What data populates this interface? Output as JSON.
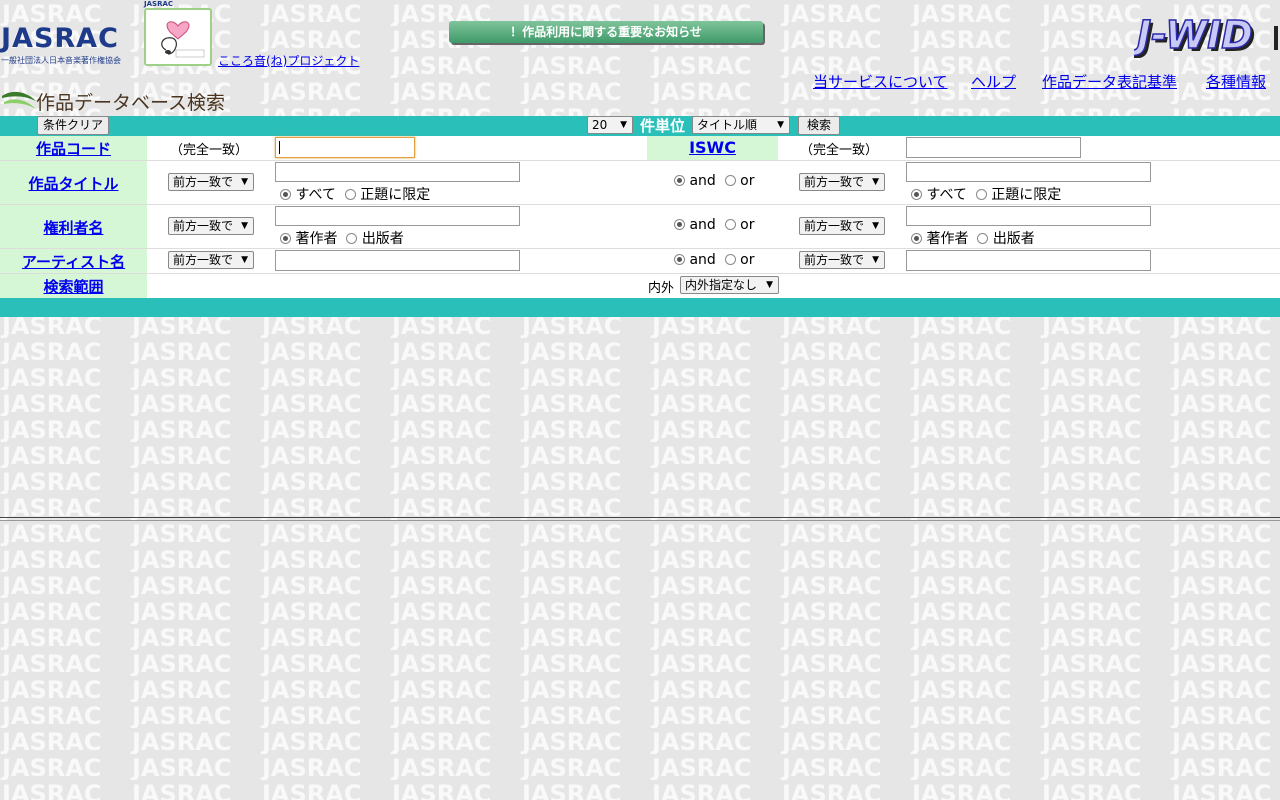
{
  "header": {
    "logo_text": "JASRAC",
    "logo_subtitle": "一般社団法人日本音楽著作権協会",
    "kokoro_mini": "JASRAC",
    "kokoro_link": "こころ音(ね)プロジェクト",
    "notice_button": "！作品利用に関する重要なお知らせ",
    "jwid_logo": "J-WID",
    "nav": {
      "about": "当サービスについて",
      "help": "ヘルプ",
      "notation": "作品データ表記基準",
      "info": "各種情報"
    },
    "page_title": "作品データベース検索"
  },
  "toolbar": {
    "clear_button": "条件クリア",
    "count_value": "20",
    "unit_label": "件単位",
    "sort_value": "タイトル順",
    "search_button": "検索"
  },
  "form": {
    "work_code": {
      "label": "作品コード",
      "match_note": "（完全一致）"
    },
    "iswc": {
      "label": "ISWC",
      "match_note": "（完全一致）"
    },
    "title": {
      "label": "作品タイトル",
      "match_mode": "前方一致で",
      "scope_all": "すべて",
      "scope_formal": "正題に限定",
      "match_mode_2": "前方一致で",
      "scope_all_2": "すべて",
      "scope_formal_2": "正題に限定"
    },
    "rights_holder": {
      "label": "権利者名",
      "match_mode": "前方一致で",
      "author": "著作者",
      "publisher": "出版者",
      "match_mode_2": "前方一致で",
      "author_2": "著作者",
      "publisher_2": "出版者"
    },
    "artist": {
      "label": "アーティスト名",
      "match_mode": "前方一致で",
      "match_mode_2": "前方一致で"
    },
    "logic": {
      "and": "and",
      "or": "or"
    },
    "range": {
      "label": "検索範囲",
      "inout_label": "内外",
      "inout_value": "内外指定なし"
    }
  },
  "colors": {
    "teal_bar": "#2bbfba",
    "label_bg": "#d6f7d6",
    "link": "#0000ee",
    "logo_blue": "#1e3a8a"
  }
}
